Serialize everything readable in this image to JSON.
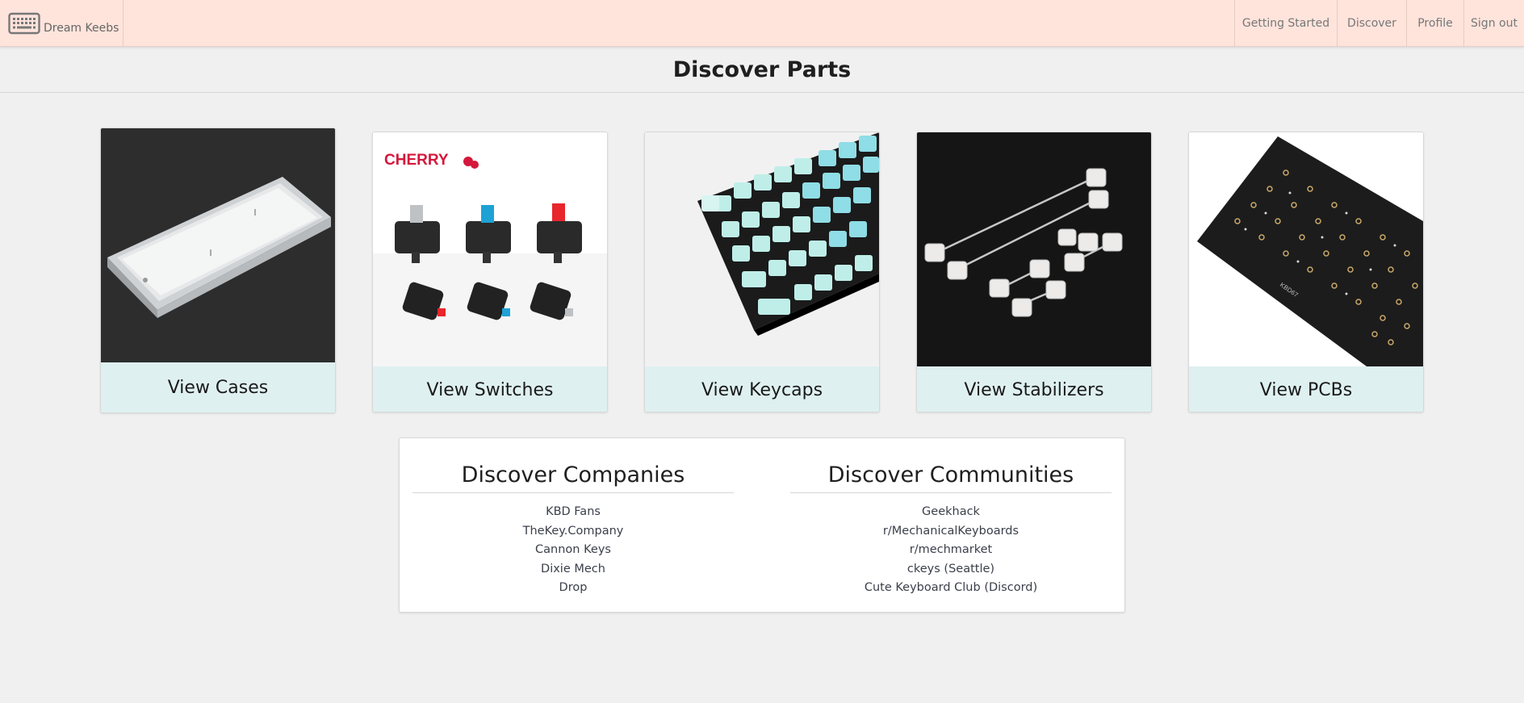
{
  "navbar": {
    "brand_name": "Dream Keebs",
    "brand_icon": "keyboard-icon",
    "links": [
      "Getting Started",
      "Discover",
      "Profile",
      "Sign out"
    ],
    "background": "#ffe4dc"
  },
  "page": {
    "title": "Discover Parts"
  },
  "parts": [
    {
      "label": "View Cases",
      "image": "aluminum-case-image"
    },
    {
      "label": "View Switches",
      "image": "cherry-switches-image",
      "brand_text": "CHERRY"
    },
    {
      "label": "View Keycaps",
      "image": "keycaps-image"
    },
    {
      "label": "View Stabilizers",
      "image": "stabilizers-image"
    },
    {
      "label": "View PCBs",
      "image": "pcb-image",
      "board_text": "KBD67"
    }
  ],
  "companies": {
    "title": "Discover Companies",
    "items": [
      "KBD Fans",
      "TheKey.Company",
      "Cannon Keys",
      "Dixie Mech",
      "Drop"
    ]
  },
  "communities": {
    "title": "Discover Communities",
    "items": [
      "Geekhack",
      "r/MechanicalKeyboards",
      "r/mechmarket",
      "ckeys (Seattle)",
      "Cute Keyboard Club (Discord)"
    ]
  },
  "colors": {
    "card_label_bg": "#dff0f0",
    "page_bg": "#f0f0f0",
    "cherry_red": "#d4183c"
  }
}
